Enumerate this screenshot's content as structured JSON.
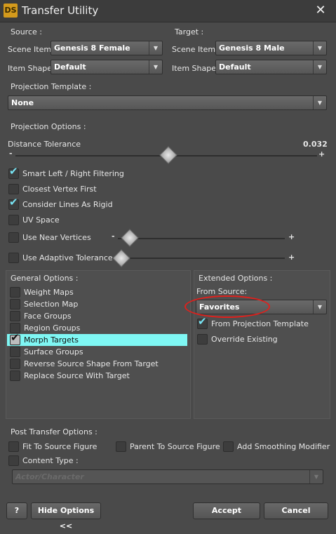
{
  "window": {
    "logo": "DS",
    "title": "Transfer Utility",
    "close": "✕"
  },
  "source": {
    "header": "Source :",
    "scene_item_label": "Scene Item :",
    "scene_item_value": "Genesis 8 Female",
    "item_shape_label": "Item Shape :",
    "item_shape_value": "Default"
  },
  "target": {
    "header": "Target :",
    "scene_item_label": "Scene Item :",
    "scene_item_value": "Genesis 8 Male",
    "item_shape_label": "Item Shape :",
    "item_shape_value": "Default"
  },
  "projection_template": {
    "header": "Projection Template :",
    "value": "None"
  },
  "projection_options": {
    "header": "Projection Options :",
    "distance_tolerance_label": "Distance Tolerance",
    "distance_tolerance_value": "0.032",
    "minus": "-",
    "plus": "+",
    "smart_filter": {
      "label": "Smart Left / Right Filtering",
      "checked": true
    },
    "closest_vertex": {
      "label": "Closest Vertex First",
      "checked": false
    },
    "consider_lines": {
      "label": "Consider Lines As Rigid",
      "checked": true
    },
    "uv_space": {
      "label": "UV Space",
      "checked": false
    },
    "near_vertices": {
      "label": "Use Near Vertices",
      "checked": false
    },
    "adaptive_tolerance": {
      "label": "Use Adaptive Tolerance",
      "checked": false
    }
  },
  "general_options": {
    "header": "General Options :",
    "items": [
      {
        "label": "Weight Maps",
        "checked": false
      },
      {
        "label": "Selection Map",
        "checked": false
      },
      {
        "label": "Face Groups",
        "checked": false
      },
      {
        "label": "Region Groups",
        "checked": false
      },
      {
        "label": "Morph Targets",
        "checked": true
      },
      {
        "label": "Surface Groups",
        "checked": false
      },
      {
        "label": "Reverse Source Shape From Target",
        "checked": false
      },
      {
        "label": "Replace Source With Target",
        "checked": false
      }
    ]
  },
  "extended_options": {
    "header": "Extended Options :",
    "from_source_label": "From Source:",
    "from_source_value": "Favorites",
    "from_projection": {
      "label": "From Projection Template",
      "checked": true
    },
    "override_existing": {
      "label": "Override Existing",
      "checked": false
    }
  },
  "post_transfer": {
    "header": "Post Transfer Options :",
    "fit_to_source": "Fit To Source Figure",
    "parent_to_source": "Parent To Source Figure",
    "add_smoothing": "Add Smoothing Modifier",
    "content_type_label": "Content Type :",
    "content_type_value": "Actor/Character"
  },
  "footer": {
    "help": "?",
    "hide_options": "Hide Options <<",
    "accept": "Accept",
    "cancel": "Cancel"
  },
  "colors": {
    "accent_cyan": "#7ff7f4",
    "check_color": "#78e5f5",
    "annotation_red": "#e0201c"
  }
}
